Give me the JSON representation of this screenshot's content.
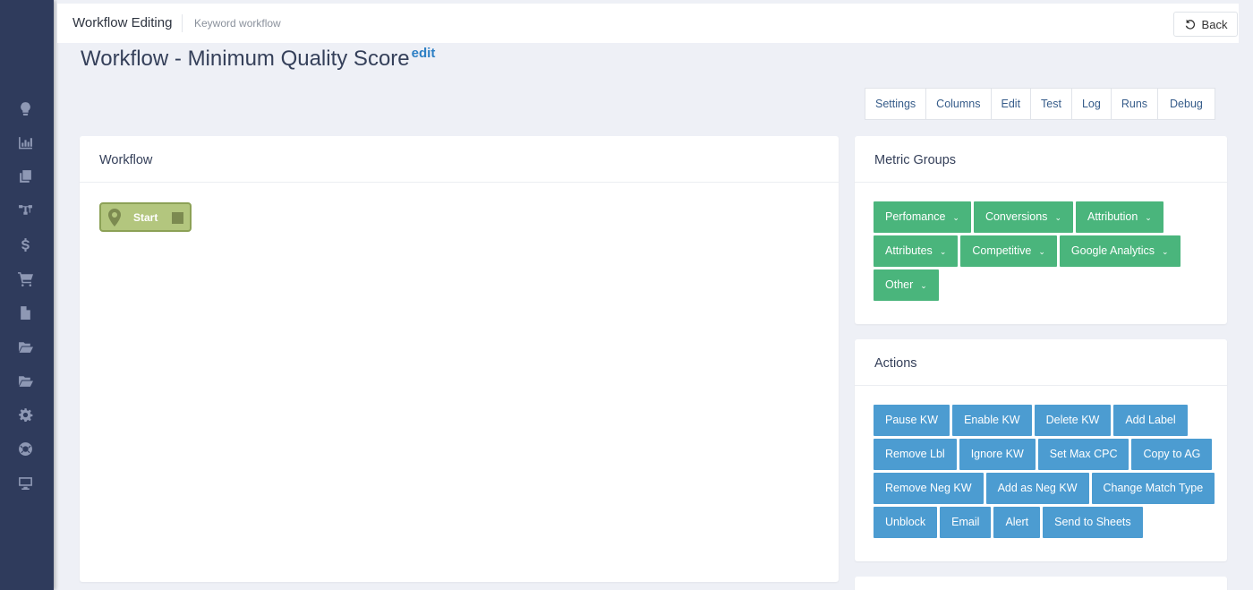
{
  "header": {
    "title": "Workflow Editing",
    "subtitle": "Keyword workflow",
    "back_label": "Back"
  },
  "page": {
    "title": "Workflow - Minimum Quality Score",
    "edit_label": "edit"
  },
  "tabs": [
    "Settings",
    "Columns",
    "Edit",
    "Test",
    "Log",
    "Runs",
    "Debug"
  ],
  "workflow_panel": {
    "title": "Workflow",
    "start_node_label": "Start"
  },
  "metric_groups": {
    "title": "Metric Groups",
    "items": [
      "Perfomance",
      "Conversions",
      "Attribution",
      "Attributes",
      "Competitive",
      "Google Analytics",
      "Other"
    ]
  },
  "actions": {
    "title": "Actions",
    "items": [
      "Pause KW",
      "Enable KW",
      "Delete KW",
      "Add Label",
      "Remove Lbl",
      "Ignore KW",
      "Set Max CPC",
      "Copy to AG",
      "Remove Neg KW",
      "Add as Neg KW",
      "Change Match Type",
      "Unblock",
      "Email",
      "Alert",
      "Send to Sheets"
    ]
  },
  "sidebar": {
    "icons": [
      "lightbulb-icon",
      "bar-chart-icon",
      "copy-icon",
      "sitemap-icon",
      "dollar-icon",
      "cart-icon",
      "file-icon",
      "folder-open-icon",
      "folder-open-icon-2",
      "gear-icon",
      "life-ring-icon",
      "desktop-icon"
    ]
  },
  "colors": {
    "sidebar": "#2f3b5c",
    "metric_button": "#4ab57c",
    "action_button": "#4c9cd1",
    "start_node": "#b3c67e",
    "edit_link": "#2c7fc4"
  }
}
